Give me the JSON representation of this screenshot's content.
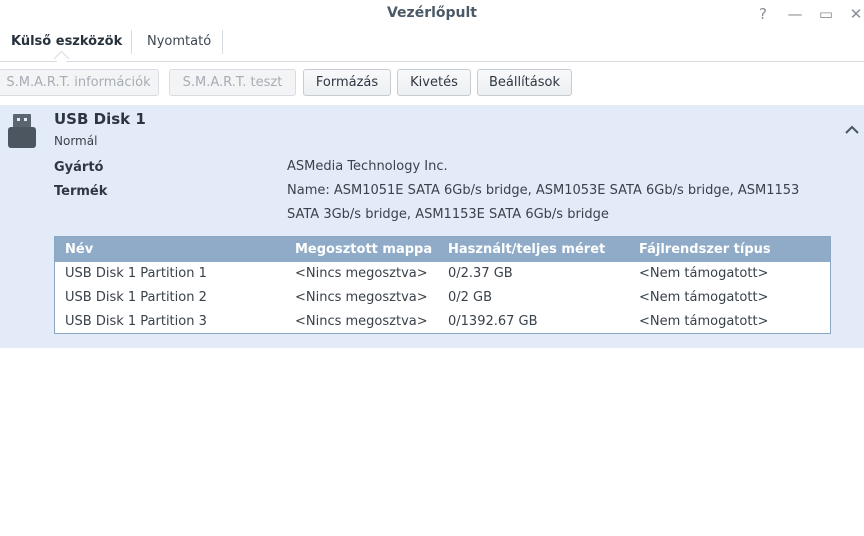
{
  "window": {
    "title": "Vezérlőpult",
    "help_glyph": "?",
    "minimize_glyph": "—",
    "maximize_glyph": "▭",
    "close_glyph": "✕"
  },
  "tabs": [
    {
      "label": "Külső eszközök",
      "active": true
    },
    {
      "label": "Nyomtató",
      "active": false
    }
  ],
  "toolbar": {
    "smart_info": "S.M.A.R.T. információk",
    "smart_test": "S.M.A.R.T. teszt",
    "format": "Formázás",
    "eject": "Kivetés",
    "settings": "Beállítások"
  },
  "device": {
    "name": "USB Disk 1",
    "status": "Normál",
    "manufacturer_label": "Gyártó",
    "manufacturer": "ASMedia Technology Inc.",
    "product_label": "Termék",
    "product": "Name: ASM1051E SATA 6Gb/s bridge, ASM1053E SATA 6Gb/s bridge, ASM1153 SATA 3Gb/s bridge, ASM1153E SATA 6Gb/s bridge"
  },
  "table": {
    "headers": [
      "Név",
      "Megosztott mappa",
      "Használt/teljes méret",
      "Fájlrendszer típus"
    ],
    "rows": [
      [
        "USB Disk 1 Partition 1",
        "<Nincs megosztva>",
        "0/2.37 GB",
        "<Nem támogatott>"
      ],
      [
        "USB Disk 1 Partition 2",
        "<Nincs megosztva>",
        "0/2 GB",
        "<Nem támogatott>"
      ],
      [
        "USB Disk 1 Partition 3",
        "<Nincs megosztva>",
        "0/1392.67 GB",
        "<Nem támogatott>"
      ]
    ]
  },
  "colors": {
    "panel_bg": "#e3ebf8",
    "table_header_bg": "#8fabc8",
    "title_text": "#4a5966"
  }
}
